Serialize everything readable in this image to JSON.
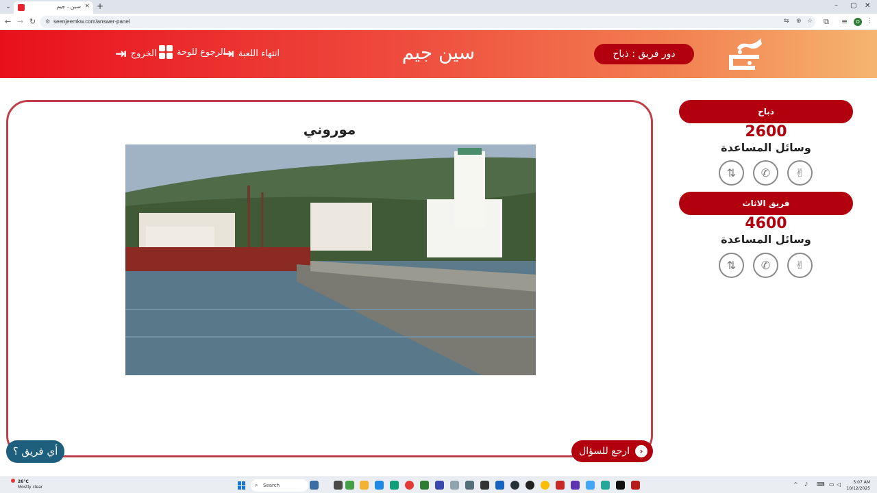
{
  "browser": {
    "tab_title": "سين ، جيم",
    "url": "seenjeemkw.com/answer-panel",
    "new_tab_glyph": "+",
    "close_glyph": "×",
    "min_glyph": "–",
    "max_glyph": "▢",
    "win_close_glyph": "✕",
    "profile_initial": "O"
  },
  "header": {
    "logo_text": "سين جيم",
    "title": "سين جيم",
    "turn_label": "دور فريق : ذباح",
    "end_game": "انتهاء اللعبة",
    "back_to_board": "الرجوع للوحة",
    "exit": "الخروج"
  },
  "question": {
    "answer": "موروني",
    "back_button": "ارجع للسؤال",
    "which_team_button": "أي فريق ؟"
  },
  "teams": [
    {
      "name": "ذباح",
      "score": "2600",
      "aids_label": "وسائل المساعدة"
    },
    {
      "name": "فريق الاثاث",
      "score": "4600",
      "aids_label": "وسائل المساعدة"
    }
  ],
  "aids_icons": [
    "two-answers-icon",
    "phone-icon",
    "hand-icon"
  ],
  "taskbar": {
    "temperature": "26°C",
    "weather": "Mostly clear",
    "search_placeholder": "Search",
    "time": "5:07 AM",
    "date": "10/12/2025"
  },
  "colors": {
    "primary_red": "#b3000f",
    "teal": "#1d5f7d",
    "card_border": "#c0404a"
  }
}
